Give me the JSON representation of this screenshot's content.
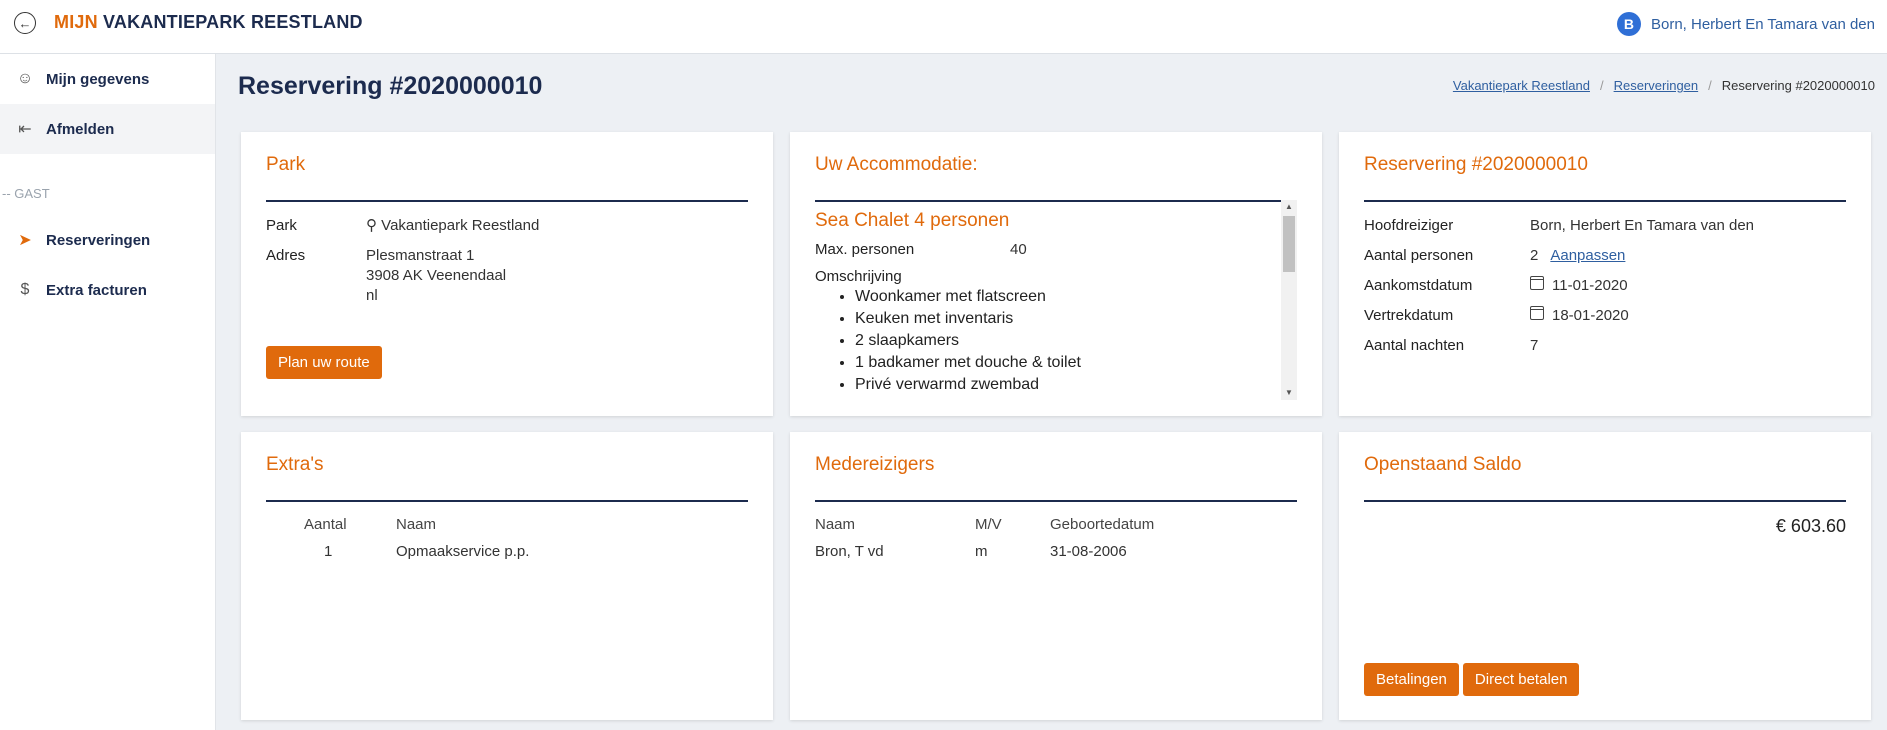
{
  "header": {
    "brand_part1": "MIJN",
    "brand_part2": "VAKANTIEPARK REESTLAND",
    "avatar_initial": "B",
    "user_name": "Born, Herbert En Tamara van den"
  },
  "sidebar": {
    "items": [
      {
        "label": "Mijn gegevens",
        "icon": "user-icon"
      },
      {
        "label": "Afmelden",
        "icon": "logout-icon"
      }
    ],
    "section_label": "-- GAST",
    "guest_items": [
      {
        "label": "Reserveringen",
        "icon": "send-icon"
      },
      {
        "label": "Extra facturen",
        "icon": "dollar-icon"
      }
    ]
  },
  "page": {
    "title": "Reservering #2020000010",
    "breadcrumbs": [
      "Vakantiepark Reestland",
      "Reserveringen",
      "Reservering #2020000010"
    ]
  },
  "park": {
    "title": "Park",
    "park_label": "Park",
    "park_value": "Vakantiepark Reestland",
    "address_label": "Adres",
    "address_lines": [
      "Plesmanstraat 1",
      "3908 AK Veenendaal",
      "nl"
    ],
    "route_button": "Plan uw route"
  },
  "accommodation": {
    "title": "Uw Accommodatie:",
    "name": "Sea Chalet 4 personen",
    "max_label": "Max. personen",
    "max_value": "40",
    "description_label": "Omschrijving",
    "features": [
      "Woonkamer met flatscreen",
      "Keuken met inventaris",
      "2 slaapkamers",
      "1 badkamer met douche & toilet",
      "Privé verwarmd zwembad"
    ]
  },
  "reservation": {
    "title": "Reservering #2020000010",
    "traveler_label": "Hoofdreiziger",
    "traveler_value": "Born, Herbert En Tamara van den",
    "persons_label": "Aantal personen",
    "persons_value": "2",
    "adjust_link": "Aanpassen",
    "arrival_label": "Aankomstdatum",
    "arrival_value": "11-01-2020",
    "departure_label": "Vertrekdatum",
    "departure_value": "18-01-2020",
    "nights_label": "Aantal nachten",
    "nights_value": "7"
  },
  "extras": {
    "title": "Extra's",
    "headers": [
      "Aantal",
      "Naam"
    ],
    "rows": [
      [
        "1",
        "Opmaakservice p.p."
      ]
    ]
  },
  "companions": {
    "title": "Medereizigers",
    "headers": [
      "Naam",
      "M/V",
      "Geboortedatum"
    ],
    "rows": [
      [
        "Bron, T vd",
        "m",
        "31-08-2006"
      ]
    ]
  },
  "balance": {
    "title": "Openstaand Saldo",
    "amount": "€ 603.60",
    "payments_button": "Betalingen",
    "pay_button": "Direct betalen"
  },
  "colors": {
    "accent": "#e06a0c",
    "navy": "#1c2b4e",
    "link": "#2f5fa0"
  }
}
